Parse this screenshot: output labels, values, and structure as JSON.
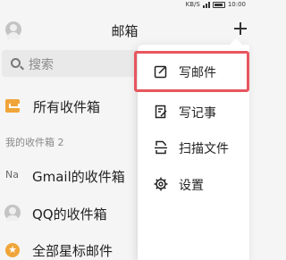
{
  "status_bar": {
    "network_speed": "KB/S",
    "time": "10:00"
  },
  "header": {
    "title": "邮箱"
  },
  "search": {
    "placeholder": "搜索"
  },
  "mailbox": {
    "all_inbox_label": "所有收件箱",
    "section_title": "我的收件箱 2",
    "accounts": [
      {
        "prefix": "Na",
        "label": "Gmail的收件箱"
      },
      {
        "label": "QQ的收件箱"
      }
    ],
    "starred_label": "全部星标邮件"
  },
  "menu": {
    "items": [
      {
        "label": "写邮件",
        "icon": "compose-icon"
      },
      {
        "label": "写记事",
        "icon": "note-icon"
      },
      {
        "label": "扫描文件",
        "icon": "scan-icon"
      },
      {
        "label": "设置",
        "icon": "gear-icon"
      }
    ]
  },
  "colors": {
    "accent": "#f0a53a",
    "highlight": "#e8565e"
  }
}
